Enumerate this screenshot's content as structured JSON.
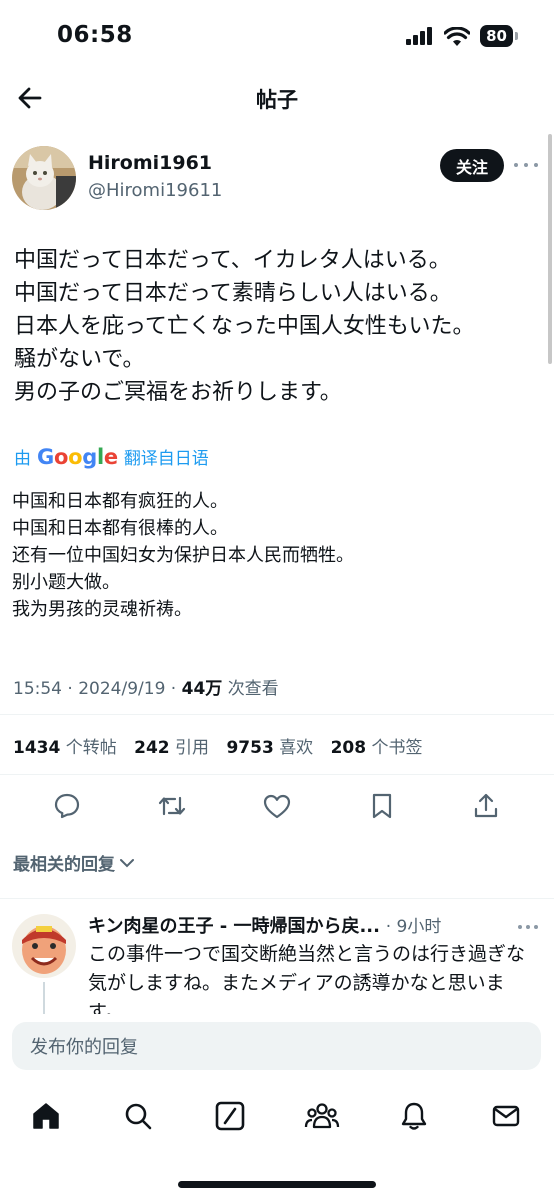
{
  "status_bar": {
    "time": "06:58",
    "battery": "80"
  },
  "header": {
    "title": "帖子"
  },
  "author": {
    "display_name": "Hiromi1961",
    "handle": "@Hiromi19611",
    "follow_label": "关注"
  },
  "tweet": {
    "lines": [
      "中国だって日本だって、イカレタ人はいる。",
      "中国だって日本だって素晴らしい人はいる。",
      "日本人を庇って亡くなった中国人女性もいた。",
      "騒がないで。",
      "男の子のご冥福をお祈りします。"
    ],
    "translate_prefix": "由",
    "translate_brand": [
      "G",
      "o",
      "o",
      "g",
      "l",
      "e"
    ],
    "translate_suffix": "翻译自日语",
    "translated_lines": [
      "中国和日本都有疯狂的人。",
      "中国和日本都有很棒的人。",
      "还有一位中国妇女为保护日本人民而牺牲。",
      "别小题大做。",
      "我为男孩的灵魂祈祷。"
    ],
    "time": "15:54",
    "date": "2024/9/19",
    "views": "44万",
    "views_label": "次查看"
  },
  "stats": {
    "retweets": "1434",
    "retweets_label": "个转帖",
    "quotes": "242",
    "quotes_label": "引用",
    "likes": "9753",
    "likes_label": "喜欢",
    "bookmarks": "208",
    "bookmarks_label": "个书签"
  },
  "sort_label": "最相关的回复",
  "reply": {
    "name": "キン肉星の王子 - 一時帰国から戻...",
    "time": "9小时",
    "text": "この事件一つで国交断絶当然と言うのは行き過ぎな気がしますね。またメディアの誘導かなと思います。"
  },
  "compose": {
    "placeholder": "发布你的回复"
  },
  "colors": {
    "accent": "#1d9bf0",
    "text": "#0f1419",
    "muted": "#536471"
  },
  "icons": [
    "back-arrow-icon",
    "more-icon",
    "reply-icon",
    "retweet-icon",
    "like-icon",
    "bookmark-icon",
    "share-icon",
    "home-icon",
    "search-icon",
    "grok-icon",
    "communities-icon",
    "notifications-icon",
    "messages-icon"
  ]
}
